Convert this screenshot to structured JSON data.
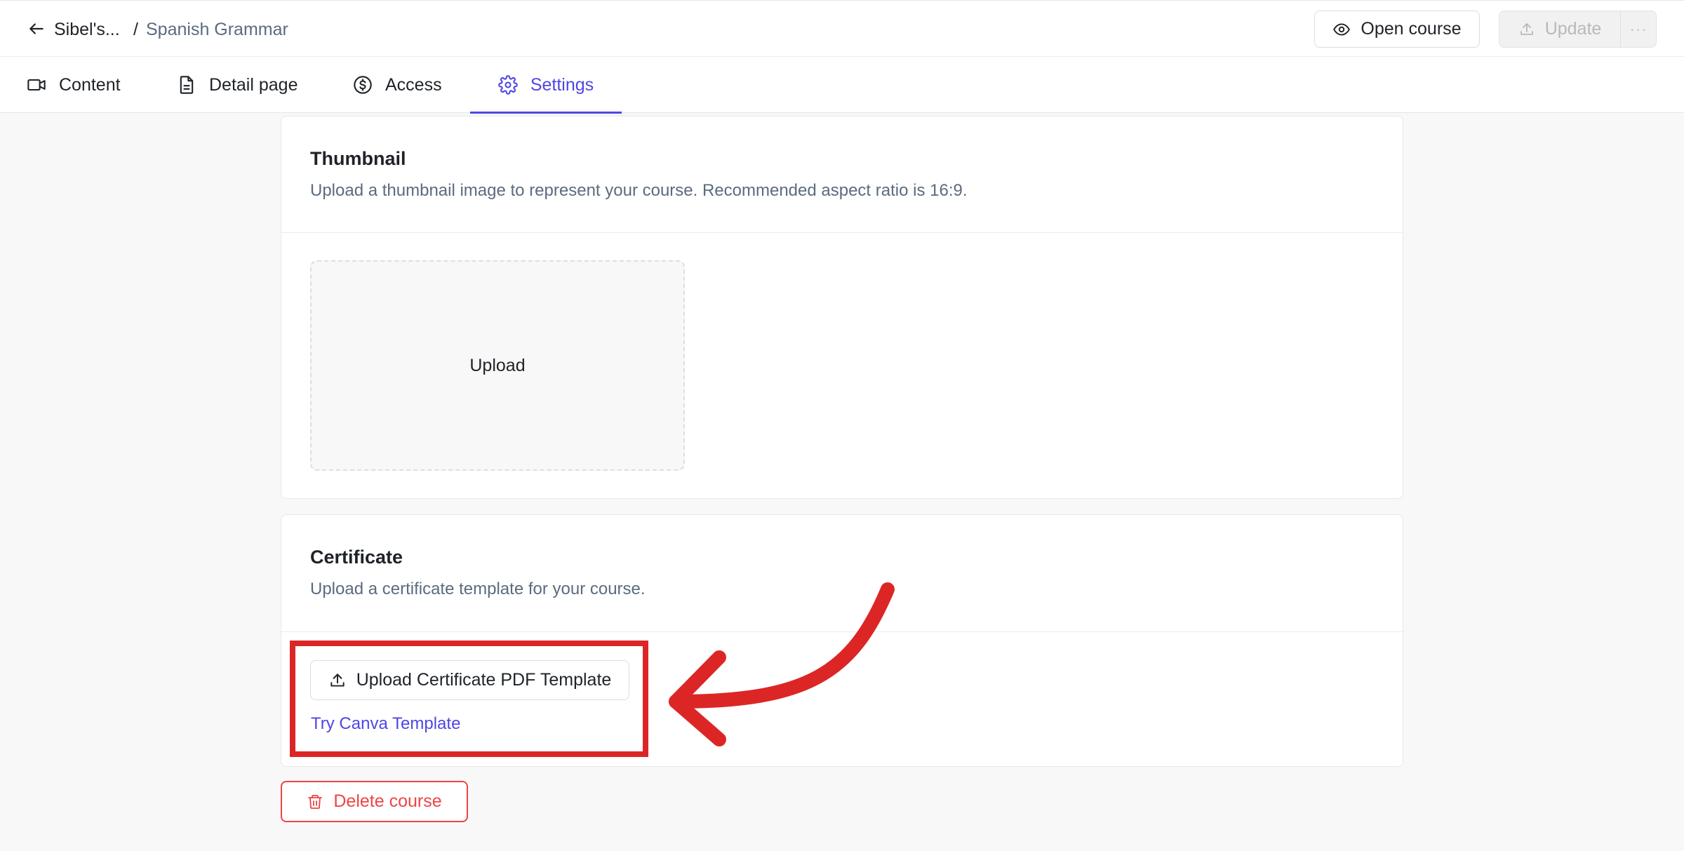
{
  "breadcrumb": {
    "parent": "Sibel's...",
    "separator": "/",
    "current": "Spanish Grammar"
  },
  "header": {
    "open_course_label": "Open course",
    "update_label": "Update",
    "more_label": "···"
  },
  "tabs": [
    {
      "label": "Content",
      "icon": "video-icon"
    },
    {
      "label": "Detail page",
      "icon": "document-icon"
    },
    {
      "label": "Access",
      "icon": "dollar-icon"
    },
    {
      "label": "Settings",
      "icon": "gear-icon",
      "active": true
    }
  ],
  "thumbnail": {
    "title": "Thumbnail",
    "description": "Upload a thumbnail image to represent your course. Recommended aspect ratio is 16:9.",
    "upload_label": "Upload"
  },
  "certificate": {
    "title": "Certificate",
    "description": "Upload a certificate template for your course.",
    "upload_button_label": "Upload Certificate PDF Template",
    "canva_link_label": "Try Canva Template"
  },
  "delete_course_label": "Delete course",
  "colors": {
    "accent": "#4f46e5",
    "danger": "#ef4444",
    "annotation": "#dc2626",
    "muted_text": "#5b6b7f"
  }
}
